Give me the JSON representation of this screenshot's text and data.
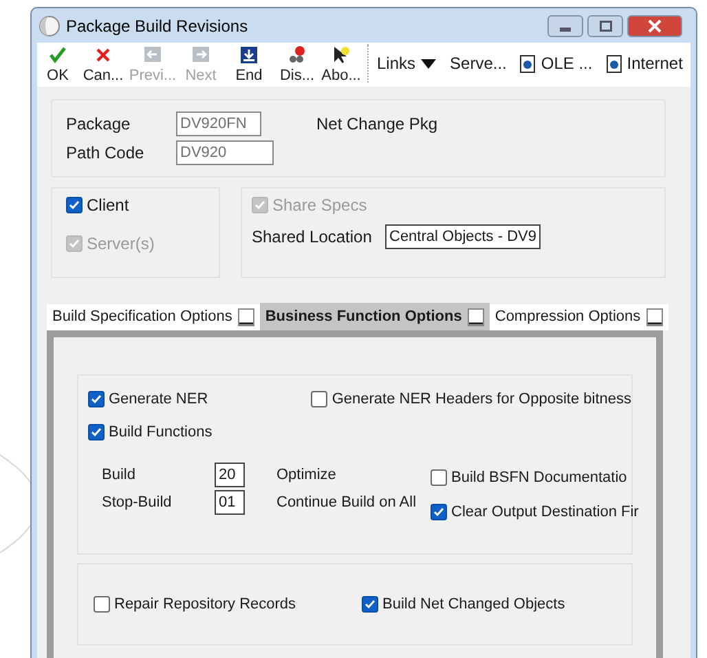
{
  "window": {
    "title": "Package Build Revisions"
  },
  "toolbar": {
    "buttons": [
      {
        "label": "OK",
        "kind": "ok",
        "disabled": false
      },
      {
        "label": "Can...",
        "kind": "cancel",
        "disabled": false
      },
      {
        "label": "Previ...",
        "kind": "previous",
        "disabled": true
      },
      {
        "label": "Next",
        "kind": "next",
        "disabled": true
      },
      {
        "label": "End",
        "kind": "end",
        "disabled": false
      },
      {
        "label": "Dis...",
        "kind": "display",
        "disabled": false
      },
      {
        "label": "Abo...",
        "kind": "about",
        "disabled": false
      }
    ],
    "links": [
      {
        "label": "Links",
        "kind": "dropdown"
      },
      {
        "label": "Serve...",
        "kind": "text"
      },
      {
        "label": "OLE ...",
        "kind": "document"
      },
      {
        "label": "Internet",
        "kind": "document"
      }
    ]
  },
  "header": {
    "package": {
      "label": "Package",
      "value": "DV920FN",
      "description": "Net Change Pkg"
    },
    "path_code": {
      "label": "Path Code",
      "value": "DV920"
    }
  },
  "targets": [
    {
      "label": "Client",
      "checked": true,
      "disabled": false
    },
    {
      "label": "Server(s)",
      "checked": true,
      "disabled": true
    }
  ],
  "share": {
    "share_specs": {
      "label": "Share Specs",
      "checked": true,
      "disabled": true
    },
    "shared_location": {
      "label": "Shared Location",
      "value": "Central Objects - DV9"
    }
  },
  "tabs": [
    {
      "label": "Build Specification Options",
      "selected": false
    },
    {
      "label": "Business Function Options",
      "selected": true
    },
    {
      "label": "Compression Options",
      "selected": false
    }
  ],
  "bsfn": {
    "generate_ner": {
      "label": "Generate NER",
      "checked": true
    },
    "generate_ner_headers": {
      "label": "Generate NER Headers for Opposite bitness",
      "checked": false
    },
    "build_functions": {
      "label": "Build Functions",
      "checked": true
    },
    "fields": [
      {
        "label": "Build",
        "value": "20",
        "description": "Optimize"
      },
      {
        "label": "Stop-Build",
        "value": "01",
        "description": "Continue Build on All"
      }
    ],
    "options": [
      {
        "label": "Build BSFN Documentatio",
        "checked": false
      },
      {
        "label": "Clear Output Destination Fir",
        "checked": true
      }
    ]
  },
  "bottom": [
    {
      "label": "Repair Repository Records",
      "checked": false
    },
    {
      "label": "Build Net Changed Objects",
      "checked": true
    }
  ]
}
